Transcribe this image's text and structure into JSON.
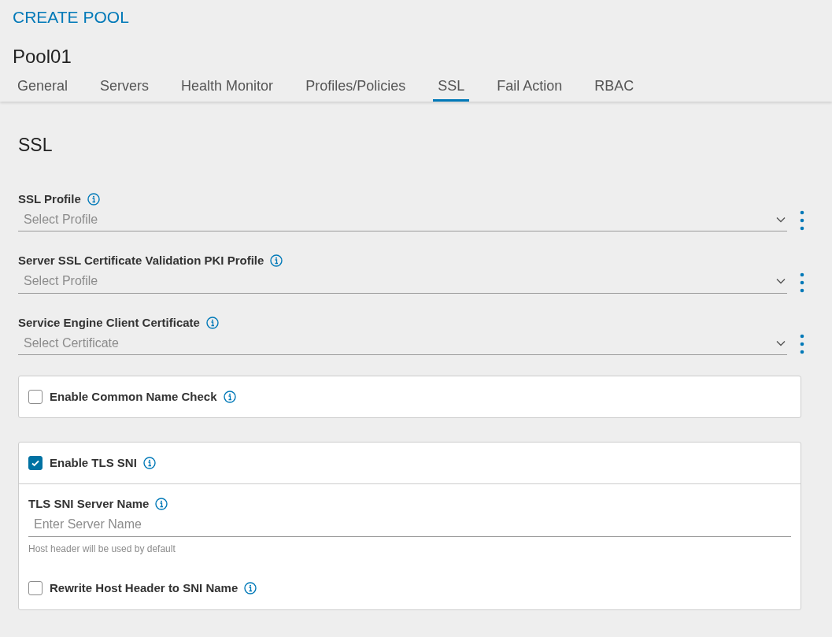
{
  "header": {
    "title": "CREATE POOL",
    "name": "Pool01"
  },
  "tabs": [
    {
      "label": "General",
      "selected": false
    },
    {
      "label": "Servers",
      "selected": false
    },
    {
      "label": "Health Monitor",
      "selected": false
    },
    {
      "label": "Profiles/Policies",
      "selected": false
    },
    {
      "label": "SSL",
      "selected": true
    },
    {
      "label": "Fail Action",
      "selected": false
    },
    {
      "label": "RBAC",
      "selected": false
    }
  ],
  "section_title": "SSL",
  "selects": [
    {
      "label": "SSL Profile",
      "placeholder": "Select Profile"
    },
    {
      "label": "Server SSL Certificate Validation PKI Profile",
      "placeholder": "Select Profile"
    },
    {
      "label": "Service Engine Client Certificate",
      "placeholder": "Select Certificate"
    }
  ],
  "common_name_check": {
    "label": "Enable Common Name Check",
    "checked": false
  },
  "tls_sni": {
    "label": "Enable TLS SNI",
    "checked": true,
    "server_name": {
      "label": "TLS SNI Server Name",
      "placeholder": "Enter Server Name",
      "help": "Host header will be used by default"
    },
    "rewrite": {
      "label": "Rewrite Host Header to SNI Name",
      "checked": false
    }
  }
}
